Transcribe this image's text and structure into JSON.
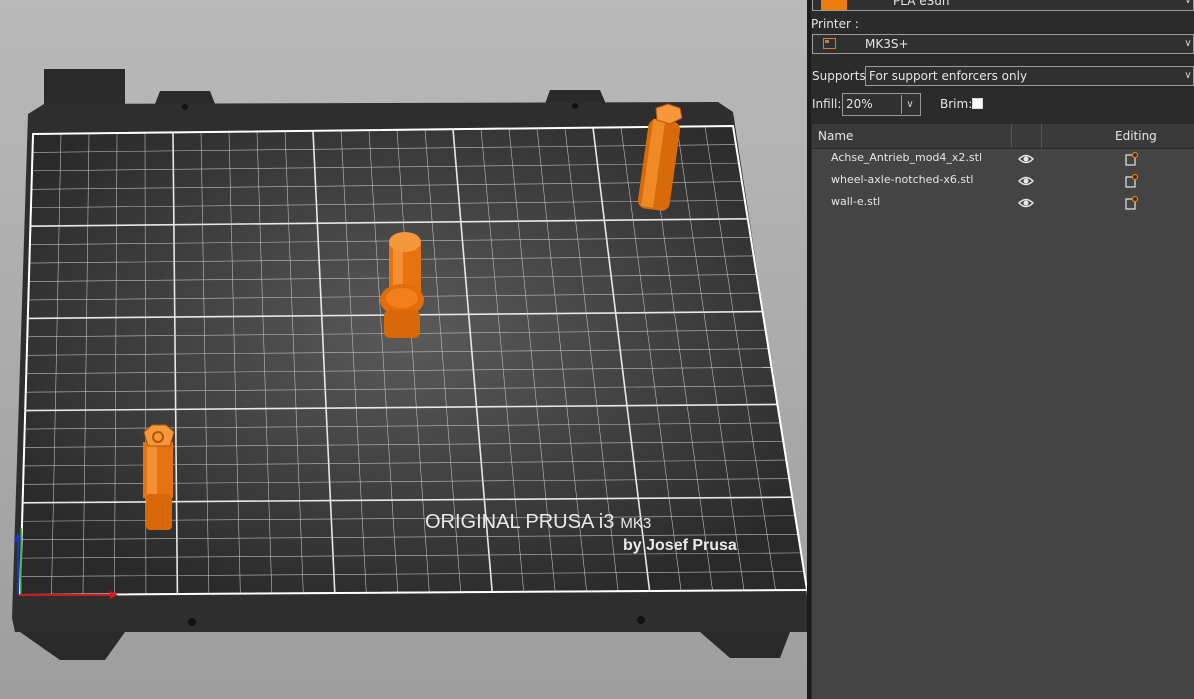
{
  "viewport": {
    "bed_logo_line1": "ORIGINAL PRUSA i3",
    "bed_logo_mk": "MK3",
    "bed_logo_line2": "by Josef Prusa"
  },
  "panel": {
    "filament": {
      "value": "PLA eSun",
      "color": "#ed7d0c"
    },
    "printer": {
      "label": "Printer :",
      "value": "MK3S+"
    },
    "supports": {
      "label": "Supports:",
      "value": "For support enforcers only"
    },
    "infill": {
      "label": "Infill:",
      "value": "20%"
    },
    "brim": {
      "label": "Brim:",
      "checked": false
    },
    "object_list": {
      "columns": {
        "name": "Name",
        "editing": "Editing"
      },
      "items": [
        {
          "name": "Achse_Antrieb_mod4_x2.stl",
          "visible_icon": "eye-icon",
          "edit_icon": "edit-icon"
        },
        {
          "name": "wheel-axle-notched-x6.stl",
          "visible_icon": "eye-icon",
          "edit_icon": "edit-icon"
        },
        {
          "name": "wall-e.stl",
          "visible_icon": "eye-icon",
          "edit_icon": "edit-icon"
        }
      ]
    }
  },
  "colors": {
    "accent": "#ed7d0c",
    "bed": "#2f2f2f",
    "background": "#2b2b2b"
  }
}
